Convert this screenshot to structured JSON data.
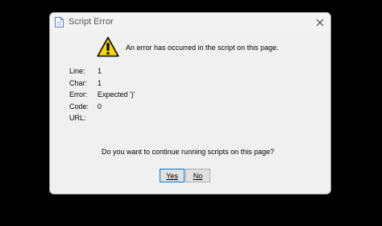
{
  "window": {
    "title": "Script Error",
    "close_glyph": "✕"
  },
  "message": "An error has occurred in the script on this page.",
  "details": [
    {
      "label": "Line:",
      "value": "1"
    },
    {
      "label": "Char:",
      "value": "1"
    },
    {
      "label": "Error:",
      "value": "Expected ')'"
    },
    {
      "label": "Code:",
      "value": "0"
    },
    {
      "label": "URL:",
      "value": ""
    }
  ],
  "question": "Do you want to continue running scripts on this page?",
  "buttons": {
    "yes_label": "Yes",
    "no_label": "No"
  },
  "icons": {
    "title": "page-icon",
    "warning": "warning-icon",
    "close": "close-icon"
  },
  "colors": {
    "warning_fill": "#f5d800",
    "focus_border": "#0078d7"
  }
}
